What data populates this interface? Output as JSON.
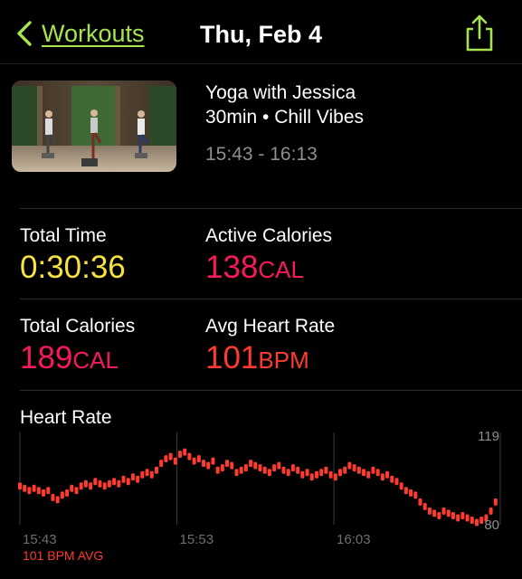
{
  "header": {
    "back_label": "Workouts",
    "title": "Thu, Feb 4"
  },
  "workout": {
    "name": "Yoga with Jessica",
    "subtitle": "30min • Chill Vibes",
    "time_range": "15:43 - 16:13"
  },
  "stats": {
    "total_time": {
      "label": "Total Time",
      "value": "0:30:36"
    },
    "active_calories": {
      "label": "Active Calories",
      "value": "138",
      "unit": "CAL"
    },
    "total_calories": {
      "label": "Total Calories",
      "value": "189",
      "unit": "CAL"
    },
    "avg_heart_rate": {
      "label": "Avg Heart Rate",
      "value": "101",
      "unit": "BPM"
    }
  },
  "heart_rate": {
    "title": "Heart Rate",
    "avg_label": "101 BPM AVG"
  },
  "colors": {
    "accent_green": "#a6e34f",
    "yellow": "#f6e33d",
    "pink": "#f9195b",
    "red": "#ff3a2e"
  },
  "icons": [
    "chevron-left-icon",
    "share-icon"
  ],
  "chart_data": {
    "type": "scatter",
    "x_tick_labels": [
      "15:43",
      "15:53",
      "16:03"
    ],
    "y_tick_labels": [
      "119",
      "80"
    ],
    "ylim": [
      80,
      119
    ],
    "xlim": [
      0,
      30.6
    ],
    "y_range_note": "",
    "series": [
      {
        "x": [
          0.0,
          0.3,
          0.6,
          0.9,
          1.2,
          1.5,
          1.8,
          2.1,
          2.4,
          2.7,
          3.0,
          3.3,
          3.6,
          3.9,
          4.2,
          4.5,
          4.8,
          5.1,
          5.4,
          5.7,
          6.0,
          6.3,
          6.6,
          6.9,
          7.2,
          7.5,
          7.8,
          8.1,
          8.4,
          8.7,
          9.0,
          9.3,
          9.6,
          9.9,
          10.2,
          10.5,
          10.8,
          11.1,
          11.4,
          11.7,
          12.0,
          12.3,
          12.6,
          12.9,
          13.2,
          13.5,
          13.8,
          14.1,
          14.4,
          14.7,
          15.0,
          15.3,
          15.6,
          15.9,
          16.2,
          16.5,
          16.8,
          17.1,
          17.4,
          17.7,
          18.0,
          18.3,
          18.6,
          18.9,
          19.2,
          19.5,
          19.8,
          20.1,
          20.4,
          20.7,
          21.0,
          21.3,
          21.6,
          21.9,
          22.2,
          22.5,
          22.8,
          23.1,
          23.4,
          23.7,
          24.0,
          24.3,
          24.6,
          24.9,
          25.2,
          25.5,
          25.8,
          26.1,
          26.4,
          26.7,
          27.0,
          27.3,
          27.6,
          27.9,
          28.2,
          28.5,
          28.8,
          29.1,
          29.4,
          29.7,
          30.0,
          30.3
        ],
        "y": [
          97,
          96,
          95,
          96,
          95,
          94,
          95,
          92,
          91,
          93,
          94,
          96,
          95,
          97,
          98,
          97,
          99,
          98,
          97,
          98,
          99,
          98,
          100,
          99,
          101,
          100,
          102,
          103,
          102,
          104,
          107,
          109,
          110,
          108,
          111,
          112,
          110,
          108,
          109,
          107,
          106,
          108,
          104,
          105,
          107,
          106,
          103,
          104,
          105,
          107,
          106,
          105,
          104,
          103,
          105,
          106,
          104,
          103,
          105,
          104,
          102,
          103,
          101,
          102,
          103,
          104,
          102,
          101,
          103,
          104,
          106,
          105,
          104,
          103,
          102,
          104,
          103,
          101,
          102,
          100,
          99,
          97,
          95,
          94,
          93,
          90,
          88,
          86,
          85,
          84,
          86,
          85,
          84,
          83,
          84,
          83,
          82,
          81,
          82,
          83,
          86,
          90
        ]
      }
    ]
  }
}
